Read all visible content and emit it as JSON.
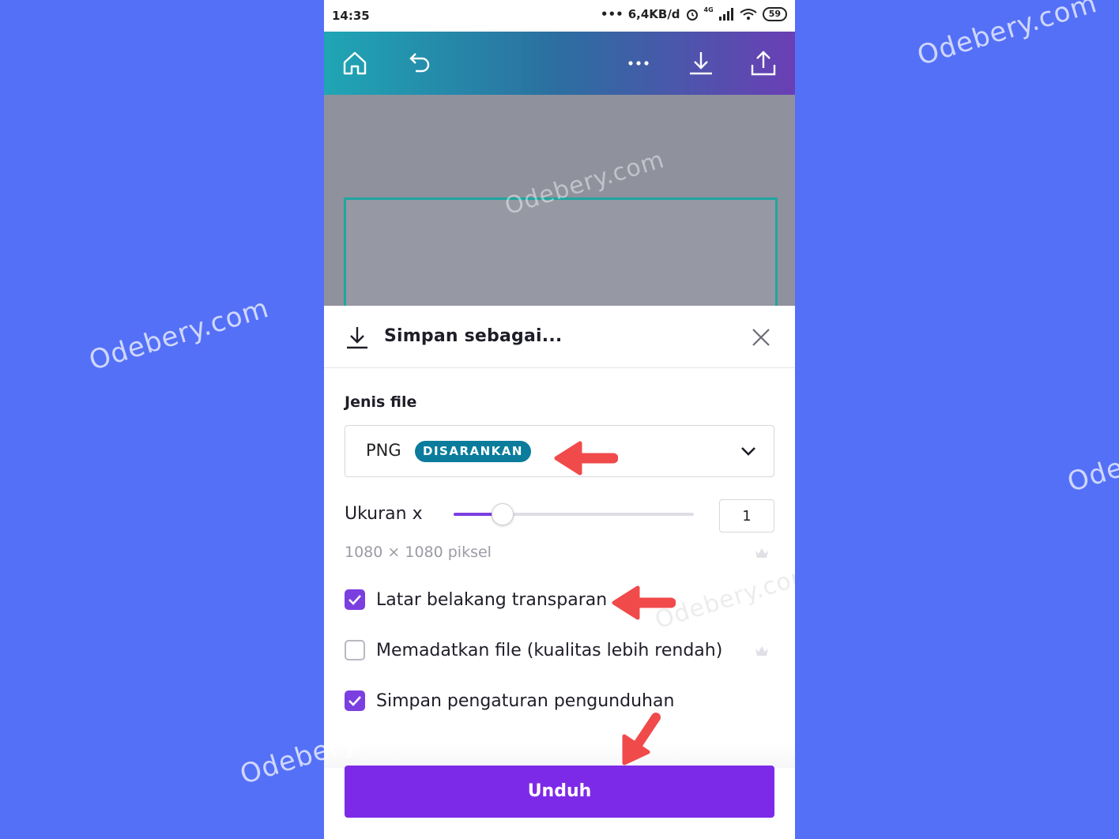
{
  "watermark": "Odebery.com",
  "status_bar": {
    "time": "14:35",
    "network_speed": "6,4KB/d",
    "signal_label": "4G",
    "battery": "59"
  },
  "toolbar": {
    "icons": [
      "home-icon",
      "undo-icon",
      "more-icon",
      "download-icon",
      "share-icon"
    ]
  },
  "dialog": {
    "title": "Simpan sebagai...",
    "file_type_label": "Jenis file",
    "file_type_value": "PNG",
    "file_type_badge": "DISARANKAN",
    "size_label": "Ukuran x",
    "size_multiplier": "1",
    "size_slider_fraction": 0.2,
    "dimensions": "1080 × 1080 piksel",
    "options": [
      {
        "label": "Latar belakang transparan",
        "checked": true
      },
      {
        "label": "Memadatkan file (kualitas lebih rendah)",
        "checked": false
      },
      {
        "label": "Simpan pengaturan pengunduhan",
        "checked": true
      }
    ],
    "download_button": "Unduh"
  },
  "colors": {
    "page_bg": "#5470f7",
    "accent_purple": "#7d2ae8",
    "badge_teal": "#0b7c9c",
    "annotation_red": "#f04a4a"
  }
}
